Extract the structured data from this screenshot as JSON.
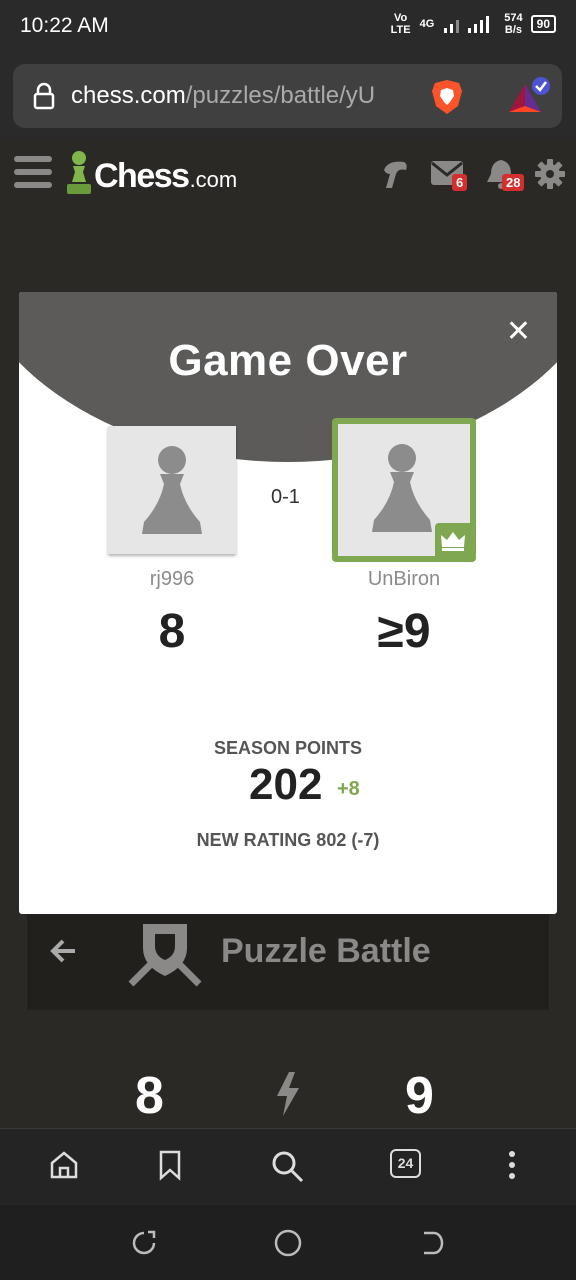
{
  "status_bar": {
    "time": "10:22 AM",
    "volte": "Vo LTE",
    "network": "4G",
    "speed_value": "574",
    "speed_unit": "B/s",
    "battery": "90"
  },
  "browser": {
    "url_host": "chess.com",
    "url_path": "/puzzles/battle/yU",
    "tab_count": "24"
  },
  "site_header": {
    "logo_word": "Chess",
    "logo_suffix": ".com",
    "messages_badge": "6",
    "notifications_badge": "28"
  },
  "modal": {
    "title": "Game Over",
    "result": "0-1",
    "player1": {
      "name": "rj996",
      "score": "8"
    },
    "player2": {
      "name": "UnBiron",
      "score": "≥9"
    },
    "season_points_label": "SEASON POINTS",
    "season_points_value": "202",
    "season_points_delta": "+8",
    "new_rating": "NEW RATING 802 (-7)"
  },
  "battle": {
    "title": "Puzzle Battle",
    "left_score": "8",
    "right_score": "9"
  },
  "colors": {
    "accent_green": "#7fa650",
    "badge_red": "#d32f2f",
    "page_bg": "#2b2926"
  }
}
